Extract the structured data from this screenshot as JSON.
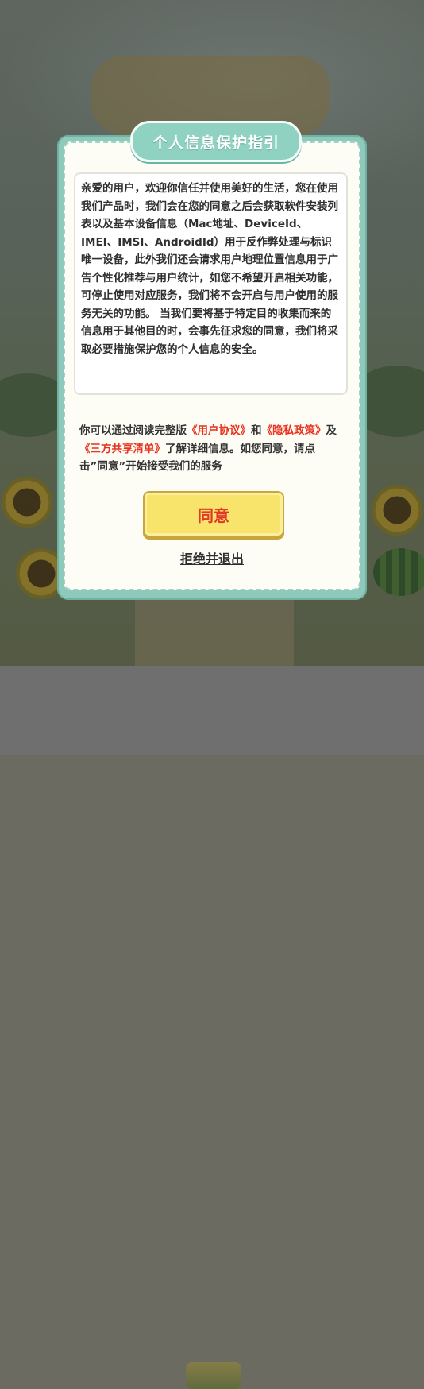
{
  "dialog": {
    "title": "个人信息保护指引",
    "body": "亲爱的用户，欢迎你信任并使用美好的生活，您在使用我们产品时，我们会在您的同意之后会获取软件安装列表以及基本设备信息（Mac地址、DeviceId、IMEI、IMSI、AndroidId）用于反作弊处理与标识唯一设备，此外我们还会请求用户地理位置信息用于广告个性化推荐与用户统计，如您不希望开启相关功能，可停止使用对应服务，我们将不会开启与用户使用的服务无关的功能。 当我们要将基于特定目的收集而来的信息用于其他目的时，会事先征求您的同意，我们将采取必要措施保护您的个人信息的安全。",
    "consent": {
      "prefix": "你可以通过阅读完整版",
      "user_agreement": "《用户协议》",
      "and": "和",
      "privacy_policy": "《隐私政策》",
      "and2": "及",
      "third_party_list": "《三方共享清单》",
      "suffix": "了解详细信息。如您同意，请点击”同意”开始接受我们的服务"
    },
    "agree_label": "同意",
    "reject_label": "拒绝并退出"
  },
  "colors": {
    "accent": "#8fc9bb",
    "link": "#e8321e",
    "button": "#f8e46a"
  }
}
